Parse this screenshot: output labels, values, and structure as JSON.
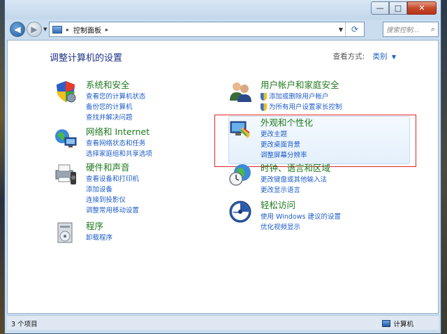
{
  "window": {
    "min": "—",
    "max": "□",
    "close": "✕"
  },
  "nav": {
    "breadcrumb": "控制面板",
    "search_placeholder": "搜索控制..."
  },
  "content": {
    "title": "调整计算机的设置",
    "view_label": "查看方式:",
    "view_value": "类别"
  },
  "categories": [
    {
      "title": "系统和安全",
      "links": [
        "查看您的计算机状态",
        "备份您的计算机",
        "查找并解决问题"
      ],
      "icon": "shield-icon"
    },
    {
      "title": "网络和 Internet",
      "links": [
        "查看网络状态和任务",
        "选择家庭组和共享选项"
      ],
      "icon": "network-icon"
    },
    {
      "title": "硬件和声音",
      "links": [
        "查看设备和打印机",
        "添加设备",
        "连接到投影仪",
        "调整常用移动设置"
      ],
      "icon": "printer-icon"
    },
    {
      "title": "程序",
      "links": [
        "卸载程序"
      ],
      "icon": "programs-icon"
    },
    {
      "title": "用户帐户和家庭安全",
      "links": [
        "添加或删除用户帐户",
        "为所有用户设置家长控制"
      ],
      "icon": "users-icon"
    },
    {
      "title": "外观和个性化",
      "links": [
        "更改主题",
        "更改桌面背景",
        "调整屏幕分辨率"
      ],
      "icon": "appearance-icon"
    },
    {
      "title": "时钟、语言和区域",
      "links": [
        "更改键盘或其他输入法",
        "更改显示语言"
      ],
      "icon": "clock-globe-icon"
    },
    {
      "title": "轻松访问",
      "links": [
        "使用 Windows 建议的设置",
        "优化视频显示"
      ],
      "icon": "ease-of-access-icon"
    }
  ],
  "status": {
    "items_count": "3 个项目",
    "computer": "计算机"
  },
  "colors": {
    "title_green": "#1f7a1f",
    "link_blue": "#1e5cc8",
    "highlight_red": "#e0222a"
  }
}
